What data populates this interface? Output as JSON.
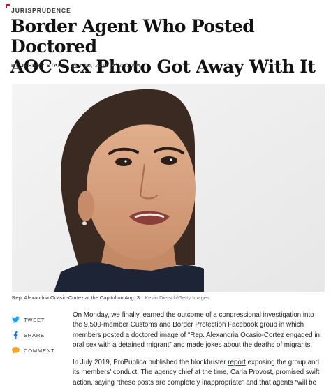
{
  "section": {
    "kicker": "JURISPRUDENCE"
  },
  "article": {
    "headline_line1": "Border Agent Who Posted Doctored",
    "headline_line2": "AOC Sex Photo Got Away With It",
    "byline_prefix": "BY",
    "author": "JEREMY STAHL",
    "date": "OCT 25, 2021",
    "separator": "•",
    "time": "3:11 PM"
  },
  "image": {
    "caption": "Rep. Alexandria Ocasio-Cortez at the Capitol on Aug. 3.",
    "credit": "Kevin Dietsch/Getty Images"
  },
  "share": {
    "items": [
      {
        "label": "TWEET",
        "icon": "twitter-icon",
        "color": "#1da1f2"
      },
      {
        "label": "SHARE",
        "icon": "facebook-icon",
        "color": "#1877f2"
      },
      {
        "label": "COMMENT",
        "icon": "comment-icon",
        "color": "#f5a623"
      }
    ]
  },
  "body": {
    "p1": "On Monday, we finally learned the outcome of a congressional investigation into the 9,500-member Customs and Border Protection Facebook group in which members posted a doctored image of “Rep. Alexandria Ocasio-Cortez engaged in oral sex with a detained migrant” and made jokes about the deaths of migrants.",
    "p2_before": "In July 2019, ProPublica published the blockbuster ",
    "p2_link": "report",
    "p2_after": " exposing the group and its members’ conduct. The agency chief at the time, Carla Provost, promised swift action, saying “these posts are completely inappropriate” and that agents “will be held accountable.”"
  },
  "colors": {
    "accent": "#c8102e"
  }
}
